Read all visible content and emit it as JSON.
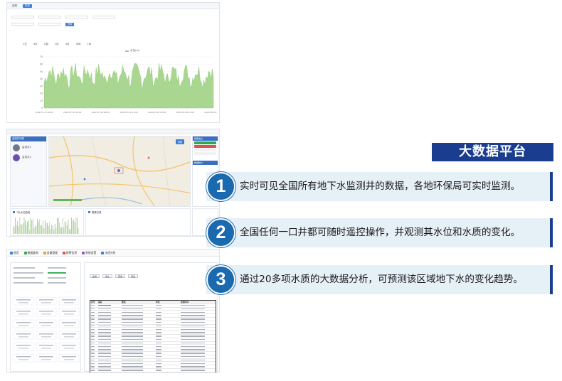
{
  "platform_title": "大数据平台",
  "features": [
    {
      "num": "1",
      "text": "实时可见全国所有地下水监测井的数据，各地环保局可实时监测。"
    },
    {
      "num": "2",
      "text": "全国任何一口井都可随时遥控操作，并观测其水位和水质的变化。"
    },
    {
      "num": "3",
      "text": "通过20多项水质的大数据分析，可预测该区域地下水的变化趋势。"
    }
  ],
  "colors": {
    "badge": "#1a3d8f",
    "circle": "#1b6ab0",
    "band": "#e6f0f7",
    "chart_fill": "#9fd084"
  },
  "shot1": {
    "tabs": [
      "实时",
      "历史"
    ],
    "ranges": [
      "1天",
      "3天",
      "1周",
      "1月",
      "3月",
      "半年",
      "1年"
    ],
    "query_label": "查询",
    "legend": "水位(m)",
    "yticks": [
      "70",
      "60",
      "50",
      "40",
      "30",
      "20",
      "10",
      "0"
    ],
    "xticks": [
      "2022-07-11 00:00",
      "2022-07-14 12:00",
      "2022-07-18 00:00",
      "2022-07-21 12:00",
      "2022-07-25 00:00",
      "2022-07-28 12:00",
      "2022-08-01 00:00"
    ]
  },
  "shot2": {
    "left_title": "监测井列表",
    "wells": [
      "监测井1",
      "监测井2"
    ],
    "map_button": "切换",
    "right_title": "报警信息",
    "right_title2": "数据统计",
    "bottom_left_title": "7天水位曲线",
    "bottom_mid_title": "报警记录"
  },
  "shot3": {
    "menu": [
      "首页",
      "数据查询",
      "设备管理",
      "报警信息",
      "系统设置",
      "水质分析"
    ],
    "buttons": [
      "启动",
      "停止",
      "查询",
      "导出"
    ],
    "headers": [
      "序号",
      "指标",
      "数值",
      "单位",
      "检测时间"
    ],
    "row_count": 24
  }
}
